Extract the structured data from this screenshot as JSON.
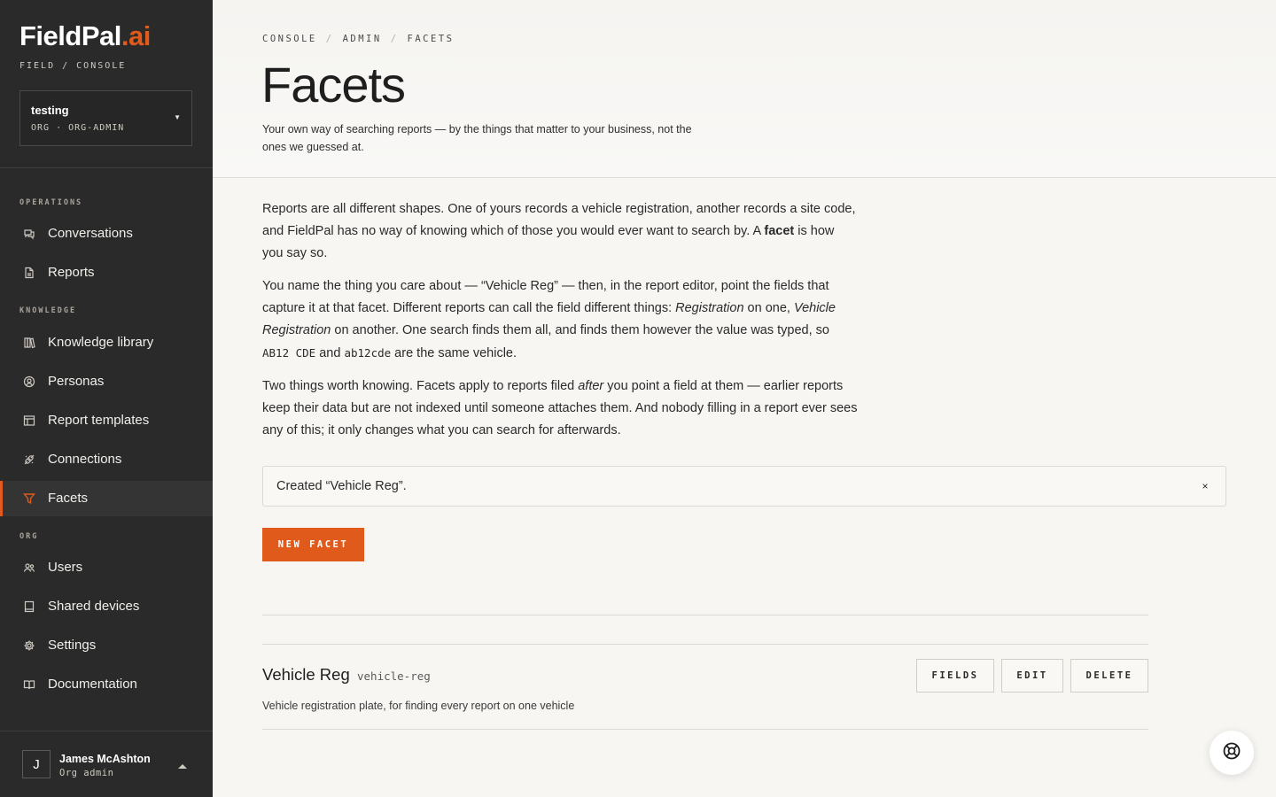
{
  "brand": {
    "name": "FieldPal",
    "accent": ".ai",
    "subtitle": "FIELD / CONSOLE"
  },
  "org": {
    "name": "testing",
    "meta": "ORG · ORG-ADMIN"
  },
  "nav": {
    "sections": {
      "operations": "OPERATIONS",
      "knowledge": "KNOWLEDGE",
      "org": "ORG"
    },
    "items": {
      "conversations": "Conversations",
      "reports": "Reports",
      "knowledge_library": "Knowledge library",
      "personas": "Personas",
      "report_templates": "Report templates",
      "connections": "Connections",
      "facets": "Facets",
      "users": "Users",
      "shared_devices": "Shared devices",
      "settings": "Settings",
      "documentation": "Documentation"
    },
    "active": "facets"
  },
  "user": {
    "initial": "J",
    "name": "James McAshton",
    "role": "Org admin"
  },
  "breadcrumb": [
    "CONSOLE",
    "ADMIN",
    "FACETS"
  ],
  "breadcrumb_sep": "/",
  "page": {
    "title": "Facets",
    "subtitle": "Your own way of searching reports — by the things that matter to your business, not the ones we guessed at."
  },
  "intro": {
    "p1_a": "Reports are all different shapes. One of yours records a vehicle registration, another records a site code, and FieldPal has no way of knowing which of those you would ever want to search by. A ",
    "p1_bold": "facet",
    "p1_b": " is how you say so.",
    "p2_a": "You name the thing you care about — “Vehicle Reg” — then, in the report editor, point the fields that capture it at that facet. Different reports can call the field different things: ",
    "p2_em1": "Registration",
    "p2_b": " on one, ",
    "p2_em2": "Vehicle Registration",
    "p2_c": " on another. One search finds them all, and finds them however the value was typed, so ",
    "p2_code1": "AB12 CDE",
    "p2_d": " and ",
    "p2_code2": "ab12cde",
    "p2_e": " are the same vehicle.",
    "p3_a": "Two things worth knowing. Facets apply to reports filed ",
    "p3_em": "after",
    "p3_b": " you point a field at them — earlier reports keep their data but are not indexed until someone attaches them. And nobody filling in a report ever sees any of this; it only changes what you can search for afterwards."
  },
  "toast": {
    "message": "Created “Vehicle Reg”.",
    "close": "×"
  },
  "actions": {
    "new_facet": "NEW FACET"
  },
  "facets": [
    {
      "name": "Vehicle Reg",
      "slug": "vehicle-reg",
      "description": "Vehicle registration plate, for finding every report on one vehicle",
      "buttons": {
        "fields": "FIELDS",
        "edit": "EDIT",
        "delete": "DELETE"
      }
    }
  ],
  "colors": {
    "accent": "#e05a1b",
    "sidebar": "#2a2a2a",
    "background": "#f7f6f3"
  },
  "icons": {
    "conversations": "chat-bubbles-icon",
    "reports": "document-icon",
    "knowledge_library": "books-icon",
    "personas": "persona-icon",
    "report_templates": "template-icon",
    "connections": "plug-icon",
    "facets": "filter-icon",
    "users": "users-icon",
    "shared_devices": "device-icon",
    "settings": "gear-icon",
    "documentation": "book-open-icon",
    "help": "lifebuoy-icon"
  }
}
